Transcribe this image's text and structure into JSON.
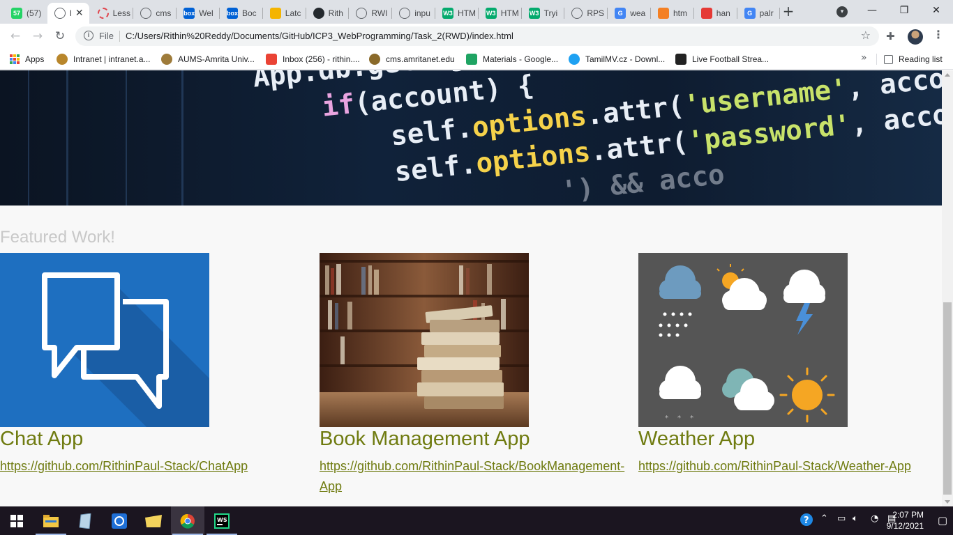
{
  "browser": {
    "tabs": [
      {
        "title": "(57)",
        "favicon": "whatsapp-icon",
        "color": "#25d366",
        "glyph": "57"
      },
      {
        "title": "I",
        "favicon": "globe-icon",
        "color": "#5f6368",
        "glyph": "",
        "active": true
      },
      {
        "title": "Less",
        "favicon": "ring-icon",
        "color": "#e0434b",
        "glyph": ""
      },
      {
        "title": "cms",
        "favicon": "globe-icon",
        "color": "#5f6368",
        "glyph": ""
      },
      {
        "title": "Wel",
        "favicon": "box-icon",
        "color": "#0061d5",
        "glyph": "box"
      },
      {
        "title": "Boc",
        "favicon": "box-icon",
        "color": "#0061d5",
        "glyph": "box"
      },
      {
        "title": "Latc",
        "favicon": "puzzle-icon",
        "color": "#f4b400",
        "glyph": ""
      },
      {
        "title": "Rith",
        "favicon": "github-icon",
        "color": "#24292e",
        "glyph": ""
      },
      {
        "title": "RWI",
        "favicon": "globe-icon",
        "color": "#5f6368",
        "glyph": ""
      },
      {
        "title": "inpu",
        "favicon": "globe-icon",
        "color": "#5f6368",
        "glyph": ""
      },
      {
        "title": "HTM",
        "favicon": "w3schools-icon",
        "color": "#04aa6d",
        "glyph": "W3"
      },
      {
        "title": "HTM",
        "favicon": "w3schools-icon",
        "color": "#04aa6d",
        "glyph": "W3"
      },
      {
        "title": "Tryi",
        "favicon": "w3schools-icon",
        "color": "#04aa6d",
        "glyph": "W3"
      },
      {
        "title": "RPS",
        "favicon": "globe-icon",
        "color": "#5f6368",
        "glyph": ""
      },
      {
        "title": "wea",
        "favicon": "google-icon",
        "color": "#4285f4",
        "glyph": "G"
      },
      {
        "title": "htm",
        "favicon": "stackoverflow-icon",
        "color": "#f48024",
        "glyph": ""
      },
      {
        "title": "han",
        "favicon": "pdf-icon",
        "color": "#e53935",
        "glyph": ""
      },
      {
        "title": "palr",
        "favicon": "google-icon",
        "color": "#4285f4",
        "glyph": "G"
      }
    ],
    "url_scheme": "File",
    "url": "C:/Users/Rithin%20Reddy/Documents/GitHub/ICP3_WebProgramming/Task_2(RWD)/index.html",
    "bookmarks": [
      {
        "label": "Apps",
        "icon": "apps-grid-icon"
      },
      {
        "label": "Intranet | intranet.a...",
        "icon": "amrita-logo-icon",
        "color": "#b8862b"
      },
      {
        "label": "AUMS-Amrita Univ...",
        "icon": "amrita-logo-icon",
        "color": "#9e7b3a"
      },
      {
        "label": "Inbox (256) - rithin....",
        "icon": "gmail-icon",
        "color": "#ea4335"
      },
      {
        "label": "cms.amritanet.edu",
        "icon": "amrita-logo-icon",
        "color": "#8a6a2a"
      },
      {
        "label": "Materials - Google...",
        "icon": "google-drive-icon",
        "color": "#1fa463"
      },
      {
        "label": "TamilMV.cz - Downl...",
        "icon": "play-circle-icon",
        "color": "#1ea1f2"
      },
      {
        "label": "Live Football Strea...",
        "icon": "football-icon",
        "color": "#222222"
      }
    ],
    "reading_list_label": "Reading list"
  },
  "page": {
    "hero_code": {
      "line0": "App.db.getLoggedA",
      "line1_kw": "if",
      "line1_rest": "(account) {",
      "line2_a": "self.",
      "line2_b": "options",
      "line2_c": ".attr(",
      "line2_d": "'username'",
      "line2_e": ", accou",
      "line3_a": "self.",
      "line3_b": "options",
      "line3_c": ".attr(",
      "line3_d": "'password'",
      "line3_e": ", accou",
      "line4": "                  ') && acco"
    },
    "section_title": "Featured Work!",
    "projects": [
      {
        "name": "Chat App",
        "link": "https://github.com/RithinPaul-Stack/ChatApp",
        "image": "chat-bubbles-image"
      },
      {
        "name": "Book Management App",
        "link": "https://github.com/RithinPaul-Stack/BookManagement-App",
        "image": "books-library-image"
      },
      {
        "name": "Weather App",
        "link": "https://github.com/RithinPaul-Stack/Weather-App",
        "image": "weather-icons-image"
      }
    ],
    "accent_color": "#6f7b10"
  },
  "taskbar": {
    "apps": [
      "windows-start-icon",
      "file-explorer-icon",
      "notepad-icon",
      "sync-icon",
      "folder-icon",
      "chrome-icon",
      "webstorm-icon"
    ],
    "clock_time": "2:07 PM",
    "clock_date": "9/12/2021"
  }
}
